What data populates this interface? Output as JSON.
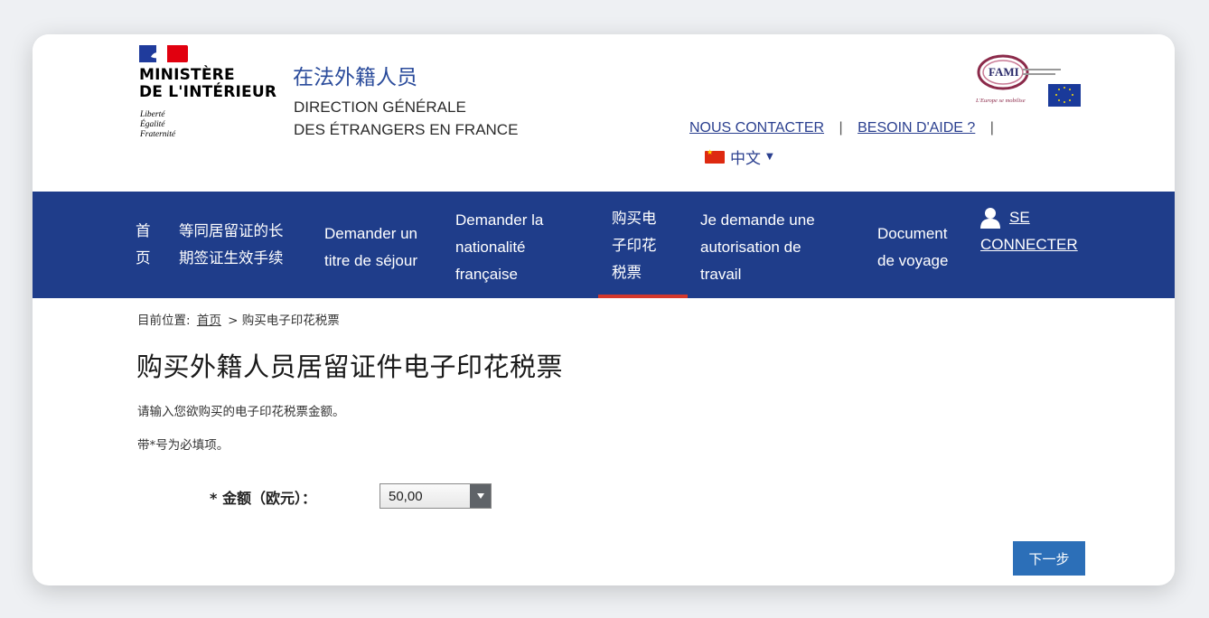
{
  "header": {
    "ministry_lines": [
      "MINISTÈRE",
      "DE L'INTÉRIEUR"
    ],
    "motto": [
      "Liberté",
      "Égalité",
      "Fraternité"
    ],
    "site_title_cn": "在法外籍人员",
    "site_title_fr_lines": [
      "DIRECTION GÉNÉRALE",
      "DES ÉTRANGERS EN FRANCE"
    ],
    "contact_link": "NOUS CONTACTER",
    "help_link": "BESOIN D'AIDE ?",
    "separator": "|",
    "language": "中文",
    "fami_text": "FAMI",
    "fami_subtitle": "L'Europe se mobilise",
    "colors": {
      "title_blue": "#2a4b9b",
      "link_blue": "#2a3f8f"
    }
  },
  "nav": {
    "background": "#1f3d8a",
    "active_indicator": "#d4382c",
    "items": [
      {
        "lines": [
          "首",
          "页"
        ]
      },
      {
        "lines": [
          "等同居留证的长",
          "期签证生效手续"
        ]
      },
      {
        "lines": [
          "Demander un",
          "titre de séjour"
        ]
      },
      {
        "lines": [
          "Demander la",
          "nationalité",
          "française"
        ]
      },
      {
        "lines": [
          "购买电",
          "子印花",
          "税票"
        ],
        "active": true
      },
      {
        "lines": [
          "Je demande une",
          "autorisation de",
          "travail"
        ]
      },
      {
        "lines": [
          "Document",
          "de voyage"
        ]
      }
    ],
    "connect_lines": [
      "SE",
      "CONNECTER"
    ]
  },
  "main": {
    "breadcrumb": {
      "prefix": "目前位置:",
      "home": "首页",
      "separator": ">",
      "current": "购买电子印花税票"
    },
    "title": "购买外籍人员居留证件电子印花税票",
    "intro": "请输入您欲购买的电子印花税票金额。",
    "required_note": "带*号为必填项。",
    "amount": {
      "label": "* 金额（欧元）：",
      "selected": "50,00"
    },
    "next_button": "下一步",
    "button_color": "#2c6fb8"
  }
}
